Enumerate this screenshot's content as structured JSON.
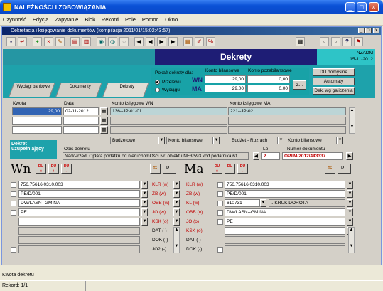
{
  "app": {
    "title": "NALEŻNOŚCI I ZOBOWIĄZANIA"
  },
  "menu": [
    "Czynność",
    "Edycja",
    "Zapytanie",
    "Blok",
    "Rekord",
    "Pole",
    "Pomoc",
    "Okno"
  ],
  "window": {
    "title": "Dekretacja i księgowanie dokumentów (kompilacja 2011/01/15:02:43:57)"
  },
  "header": {
    "title": "Dekrety",
    "user": "NZADM",
    "date": "15-11-2012"
  },
  "filter": {
    "label": "Pokaż dekrety dla:",
    "opt_przelewu": "Przelewu",
    "opt_wyciagu": "Wyciągu",
    "wn_label": "WN",
    "ma_label": "MA",
    "col_bil": "Konto bilansowe",
    "col_pozabil": "Konto pozabilansowe",
    "wn_bil": "29,00",
    "wn_poza": "0,00",
    "ma_bil": "29,00",
    "ma_poza": "0,00",
    "sum_btn": "Σ..."
  },
  "buttons": {
    "du_domyslne": "DU domyślne",
    "automaty": "Automaty",
    "dek_wg": "Dek. wg galiczenia"
  },
  "tabs": [
    "Wyciągi bankowe",
    "Dokumenty",
    "Dekrety"
  ],
  "entry": {
    "kwota_label": "Kwota",
    "data_label": "Data",
    "konto_wn_label": "Konto księgowe WN",
    "konto_ma_label": "Konto księgowe MA",
    "kwota": "29,00",
    "data": "02-11-2012",
    "konto_wn": "136--JP-01-01",
    "konto_ma": "221--JP-02",
    "sel1": "Budżetowe",
    "sel2": "Konto bilansowe",
    "sel3": "Budżet - Rozrach",
    "sel4": "Konto bilansowe",
    "lp_label": "Lp",
    "lp": "2",
    "nr_dok_label": "Numer dokumentu",
    "nr_dok": "OPIIM/2012/443337",
    "opis_label": "Opis dekretu",
    "opis": "Nad/Przed.  Opłata podatku od nieruchomOści Nr. obiektu NF3/593 kod podatnika 61",
    "dekret_label": "Dekret uzupełniający"
  },
  "wn": {
    "label": "Wn",
    "du_label": "DU",
    "p_label": "P...",
    "rows": [
      "756.75616.0310.003",
      "PE/D/001",
      "DW/LASN--GMINA",
      "PE",
      "",
      "",
      "",
      "",
      ""
    ],
    "types": [
      "KLR (w)",
      "ZB (w)",
      "OBB (w)",
      "JO (w)",
      "KSK (o)",
      "DAT (-)",
      "DOK (-)",
      "JO2 (-)"
    ]
  },
  "ma": {
    "label": "Ma",
    "du_label": "DU",
    "p_label": "P...",
    "rows": [
      "756.75616.0310.003",
      "PE/D/001",
      "610731",
      "DW/LASN--GMINA",
      "PE",
      "",
      "",
      ""
    ],
    "kruk": "...KRUK DOROTA",
    "types": [
      "KLR (w)",
      "ZB (w)",
      "KL (w)",
      "OBB (o)",
      "JO (o)",
      "KSK (o)",
      "DAT (-)",
      "DOK (-)"
    ]
  },
  "status": {
    "line1": "Kwota dekretu",
    "line2": "Rekord: 1/1"
  },
  "colors": {
    "teal": "#1ea2ab",
    "navy": "#1e1d75",
    "selection": "#3264b4"
  }
}
